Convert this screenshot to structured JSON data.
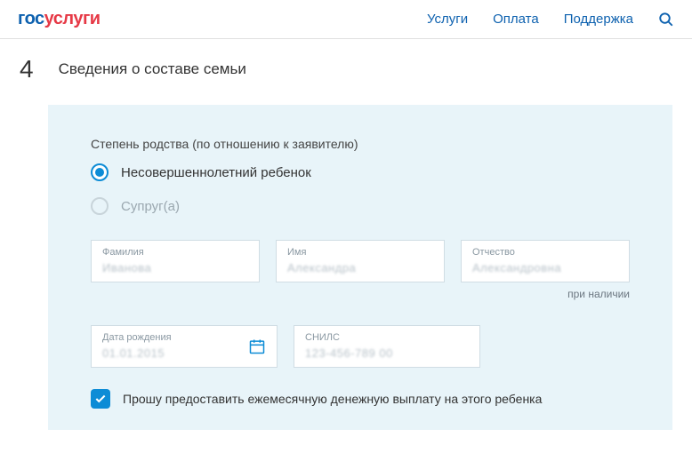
{
  "header": {
    "logo_part1": "гос",
    "logo_part2": "услуги",
    "nav": {
      "services": "Услуги",
      "payment": "Оплата",
      "support": "Поддержка"
    }
  },
  "step": {
    "number": "4",
    "title": "Сведения о составе семьи"
  },
  "form": {
    "relationship_label": "Степень родства (по отношению к заявителю)",
    "options": {
      "child": "Несовершеннолетний ребенок",
      "spouse": "Супруг(а)"
    },
    "fields": {
      "surname": {
        "label": "Фамилия",
        "value": "Иванова"
      },
      "name": {
        "label": "Имя",
        "value": "Александра"
      },
      "patronymic": {
        "label": "Отчество",
        "value": "Александровна"
      },
      "birthdate": {
        "label": "Дата рождения",
        "value": "01.01.2015"
      },
      "snils": {
        "label": "СНИЛС",
        "value": "123-456-789 00"
      }
    },
    "hint_presence": "при наличии",
    "checkbox_payment": "Прошу предоставить ежемесячную денежную выплату на этого ребенка"
  }
}
